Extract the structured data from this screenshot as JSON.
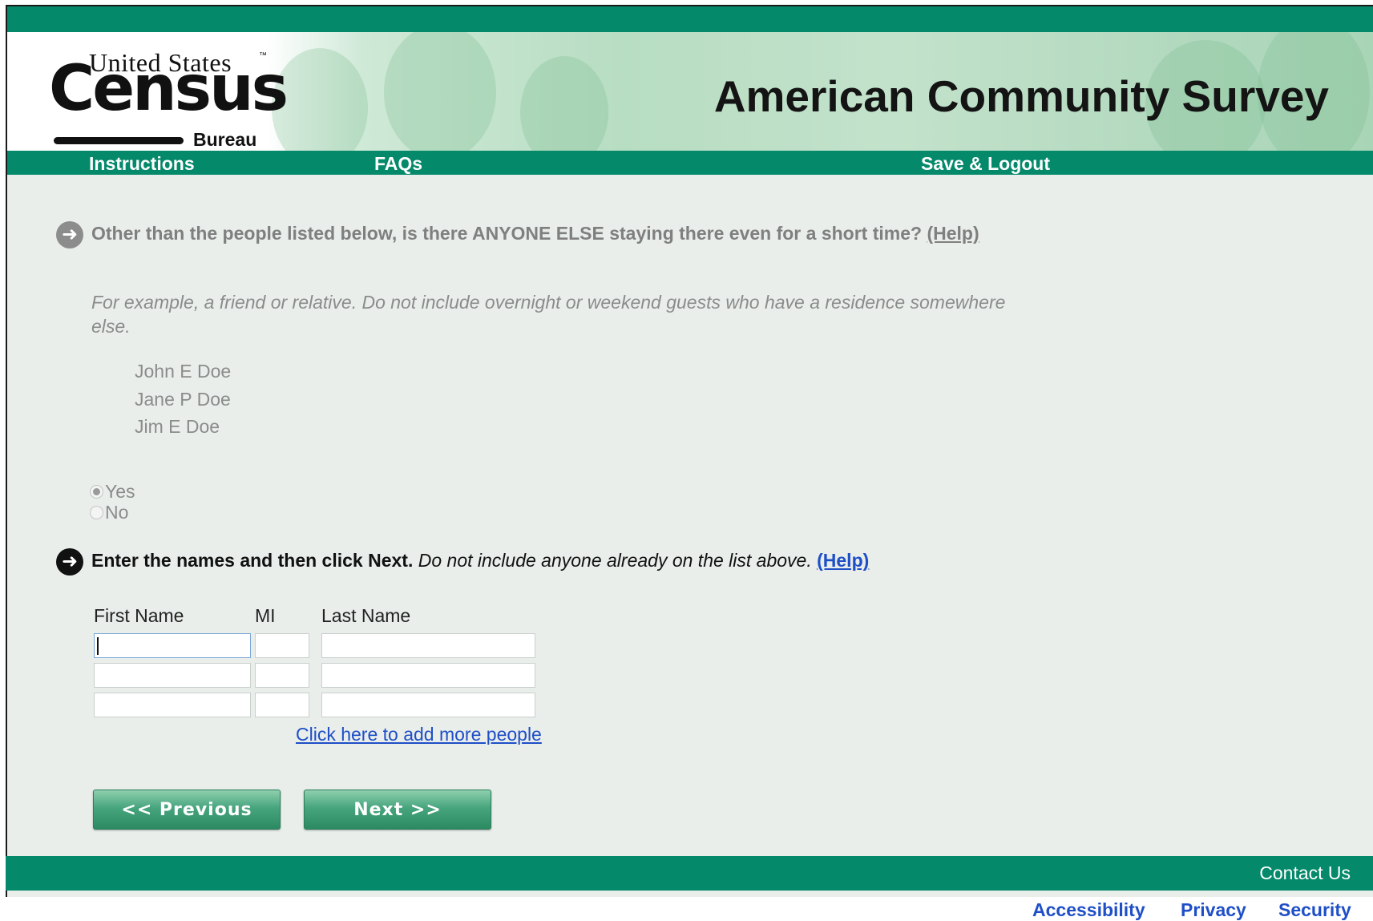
{
  "header": {
    "logo": {
      "line1": "United States",
      "tm": "™",
      "wordmark": "Census",
      "line3": "Bureau"
    },
    "title": "American Community Survey"
  },
  "nav": {
    "instructions": "Instructions",
    "faqs": "FAQs",
    "save_logout": "Save & Logout"
  },
  "question1": {
    "text": "Other than the people listed below, is there ANYONE ELSE staying there even for a short time?",
    "help": "(Help)",
    "instruction": "For example, a friend or relative. Do not include overnight or weekend guests who have a residence somewhere else.",
    "people": [
      "John E Doe",
      "Jane P Doe",
      "Jim E Doe"
    ],
    "options": [
      {
        "label": "Yes",
        "selected": true
      },
      {
        "label": "No",
        "selected": false
      }
    ]
  },
  "question2": {
    "bold_text": "Enter the names and then click Next.",
    "italic_text": "Do not include anyone already on the list above.",
    "help": "(Help)",
    "columns": {
      "first": "First Name",
      "mi": "MI",
      "last": "Last Name"
    },
    "rows": [
      {
        "first": "",
        "mi": "",
        "last": ""
      },
      {
        "first": "",
        "mi": "",
        "last": ""
      },
      {
        "first": "",
        "mi": "",
        "last": ""
      }
    ],
    "add_more": "Click here to add more people"
  },
  "buttons": {
    "previous": "<<   Previous",
    "next": "Next   >>"
  },
  "footer": {
    "contact": "Contact Us",
    "links": [
      "Accessibility",
      "Privacy",
      "Security"
    ]
  },
  "colors": {
    "brand_green": "#04896a",
    "link_blue": "#1f4fc7",
    "page_background": "#e9eeeb"
  },
  "icons": {
    "question_marker": "arrow-right-circle-icon"
  }
}
